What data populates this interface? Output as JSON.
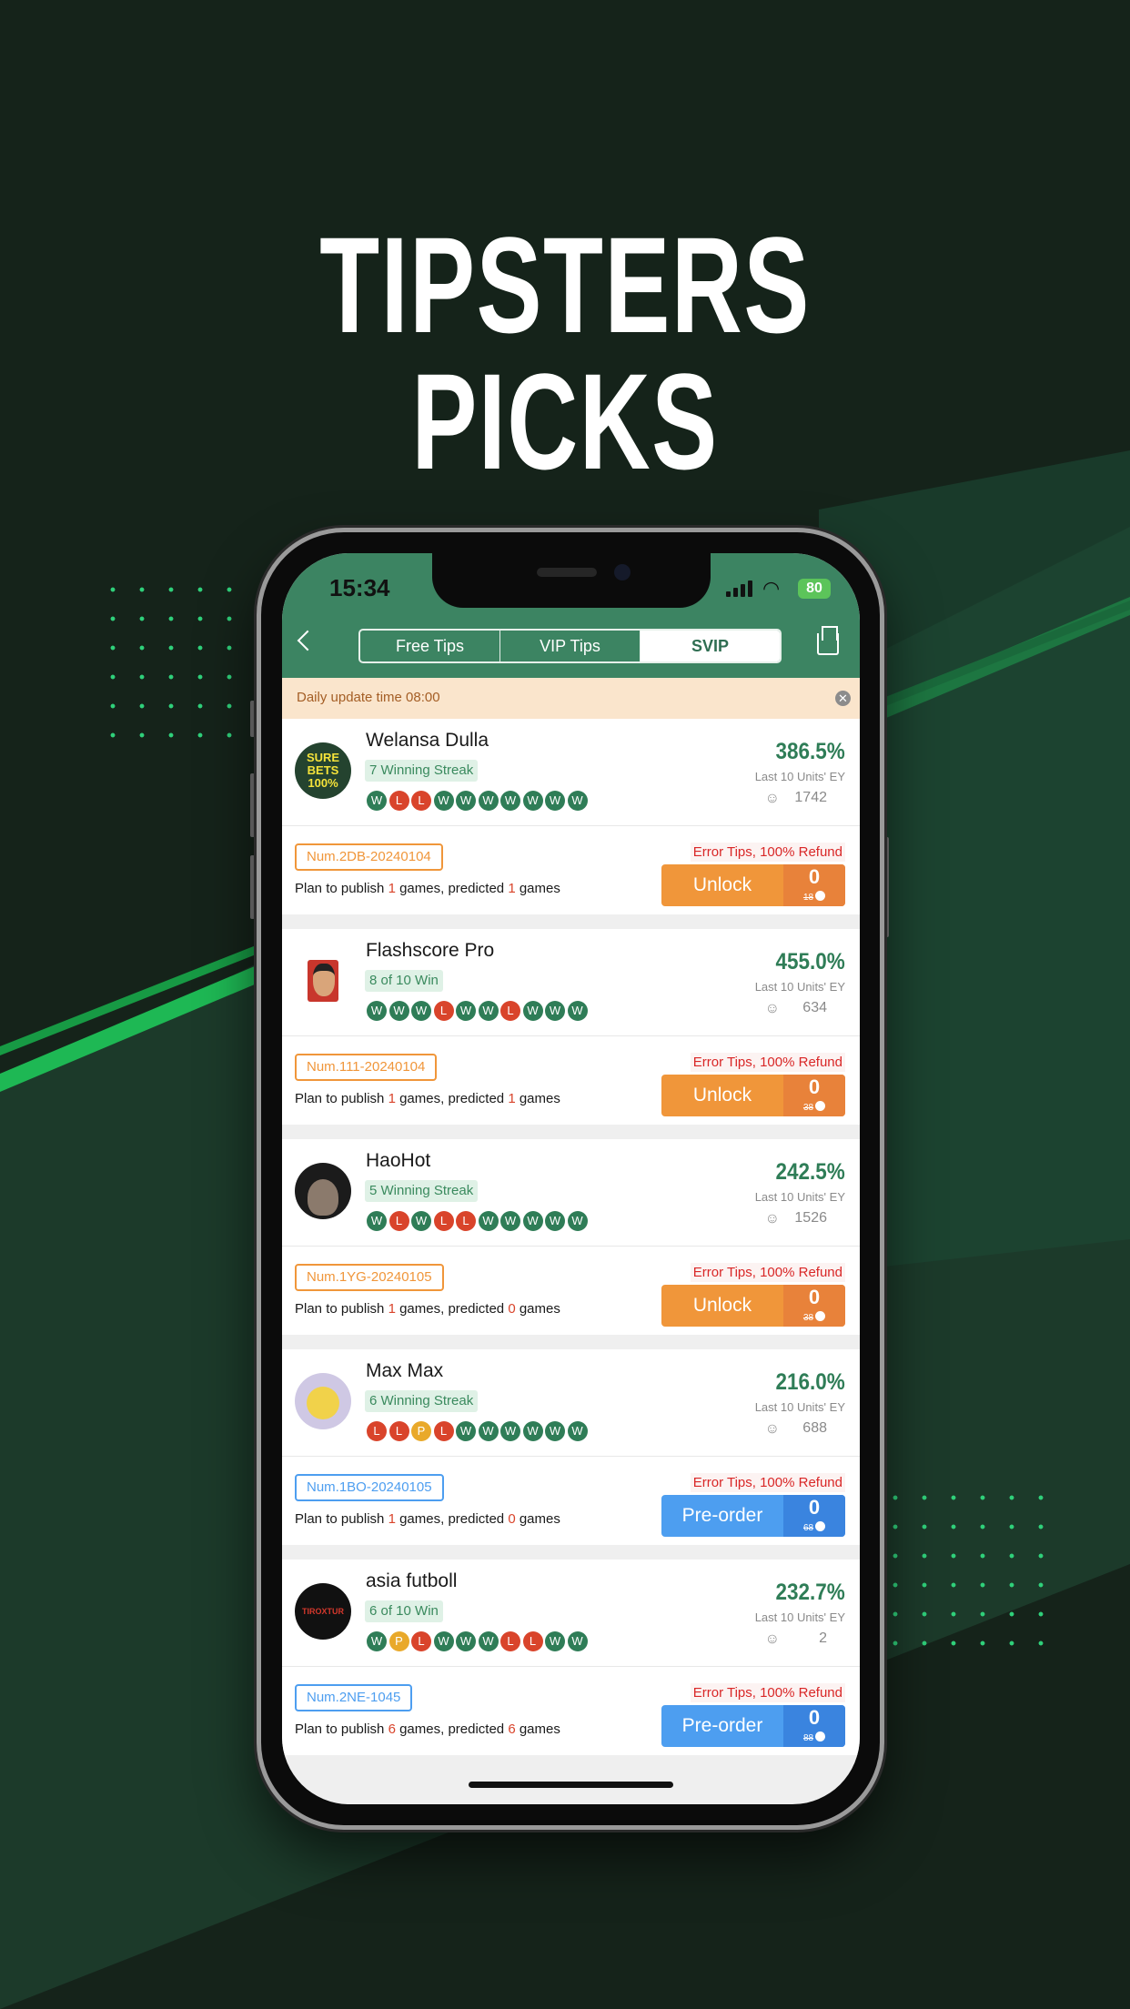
{
  "headline": "TIPSTERS PICKS",
  "colors": {
    "brand_green": "#3c8462",
    "win": "#2f7d57",
    "loss": "#d9442b",
    "push": "#e9a92a",
    "unlock": "#f0963a",
    "unlock_dark": "#e8823a",
    "preorder": "#4d9ef0",
    "preorder_dark": "#3a84df",
    "bg": "#15231a"
  },
  "status_bar": {
    "time": "15:34",
    "battery": "80"
  },
  "nav": {
    "back_icon": "chevron-left-icon",
    "tabs": [
      {
        "label": "Free Tips",
        "active": false
      },
      {
        "label": "VIP Tips",
        "active": false
      },
      {
        "label": "SVIP",
        "active": true
      }
    ],
    "message_icon": "inbox-icon"
  },
  "banner": {
    "text": "Daily update time 08:00",
    "close_icon": "close-icon"
  },
  "cards": [
    {
      "name": "Welansa Dulla",
      "avatar": "SURE BETS 100%",
      "streak": "7 Winning Streak",
      "results": [
        "W",
        "L",
        "L",
        "W",
        "W",
        "W",
        "W",
        "W",
        "W",
        "W"
      ],
      "percent": "386.5%",
      "ey_label": "Last 10 Units' EY",
      "followers": "1742",
      "num": "Num.2DB-20240104",
      "plan": [
        "Plan to publish ",
        "1",
        " games, predicted ",
        "1",
        " games"
      ],
      "refund": "Error Tips, 100% Refund",
      "action": "Unlock",
      "price": "0",
      "old_price": "18"
    },
    {
      "name": "Flashscore Pro",
      "avatar": "",
      "streak": "8 of 10 Win",
      "results": [
        "W",
        "W",
        "W",
        "L",
        "W",
        "W",
        "L",
        "W",
        "W",
        "W"
      ],
      "percent": "455.0%",
      "ey_label": "Last 10 Units' EY",
      "followers": "634",
      "num": "Num.111-20240104",
      "plan": [
        "Plan to publish ",
        "1",
        " games, predicted ",
        "1",
        " games"
      ],
      "refund": "Error Tips, 100% Refund",
      "action": "Unlock",
      "price": "0",
      "old_price": "38"
    },
    {
      "name": "HaoHot",
      "avatar": "",
      "streak": "5 Winning Streak",
      "results": [
        "W",
        "L",
        "W",
        "L",
        "L",
        "W",
        "W",
        "W",
        "W",
        "W"
      ],
      "percent": "242.5%",
      "ey_label": "Last 10 Units' EY",
      "followers": "1526",
      "num": "Num.1YG-20240105",
      "plan": [
        "Plan to publish ",
        "1",
        " games, predicted ",
        "0",
        " games"
      ],
      "refund": "Error Tips, 100% Refund",
      "action": "Unlock",
      "price": "0",
      "old_price": "38"
    },
    {
      "name": "Max Max",
      "avatar": "",
      "streak": "6 Winning Streak",
      "results": [
        "L",
        "L",
        "P",
        "L",
        "W",
        "W",
        "W",
        "W",
        "W",
        "W"
      ],
      "percent": "216.0%",
      "ey_label": "Last 10 Units' EY",
      "followers": "688",
      "num": "Num.1BO-20240105",
      "plan": [
        "Plan to publish ",
        "1",
        " games, predicted ",
        "0",
        " games"
      ],
      "refund": "Error Tips, 100% Refund",
      "action": "Pre-order",
      "price": "0",
      "old_price": "68"
    },
    {
      "name": "asia futboll",
      "avatar": "TIROXTUR",
      "streak": "6 of 10 Win",
      "results": [
        "W",
        "P",
        "L",
        "W",
        "W",
        "W",
        "L",
        "L",
        "W",
        "W"
      ],
      "percent": "232.7%",
      "ey_label": "Last 10 Units' EY",
      "followers": "2",
      "num": "Num.2NE-1045",
      "plan": [
        "Plan to publish ",
        "6",
        " games, predicted ",
        "6",
        " games"
      ],
      "refund": "Error Tips, 100% Refund",
      "action": "Pre-order",
      "price": "0",
      "old_price": "88"
    }
  ]
}
